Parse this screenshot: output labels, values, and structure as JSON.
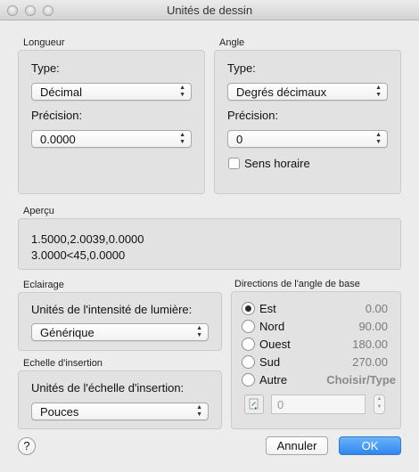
{
  "window": {
    "title": "Unités de dessin"
  },
  "length": {
    "group_label": "Longueur",
    "type_label": "Type:",
    "type_value": "Décimal",
    "precision_label": "Précision:",
    "precision_value": "0.0000"
  },
  "angle": {
    "group_label": "Angle",
    "type_label": "Type:",
    "type_value": "Degrés décimaux",
    "precision_label": "Précision:",
    "precision_value": "0",
    "clockwise_label": "Sens horaire"
  },
  "preview": {
    "group_label": "Aperçu",
    "line1": "1.5000,2.0039,0.0000",
    "line2": "3.0000<45,0.0000"
  },
  "lighting": {
    "group_label": "Eclairage",
    "intensity_label": "Unités de l'intensité de lumière:",
    "intensity_value": "Générique"
  },
  "insertion": {
    "group_label": "Echelle d'insertion",
    "scale_label": "Unités de l'échelle d'insertion:",
    "scale_value": "Pouces"
  },
  "directions": {
    "group_label": "Directions de l'angle de base",
    "options": [
      {
        "label": "Est",
        "value": "0.00",
        "selected": true
      },
      {
        "label": "Nord",
        "value": "90.00",
        "selected": false
      },
      {
        "label": "Ouest",
        "value": "180.00",
        "selected": false
      },
      {
        "label": "Sud",
        "value": "270.00",
        "selected": false
      },
      {
        "label": "Autre",
        "value": "Choisir/Type",
        "selected": false
      }
    ],
    "other_angle_value": "0"
  },
  "buttons": {
    "help": "?",
    "cancel": "Annuler",
    "ok": "OK"
  },
  "colors": {
    "default_button": "#2f86f0",
    "panel": "#e2e2e2",
    "window": "#ececec"
  }
}
